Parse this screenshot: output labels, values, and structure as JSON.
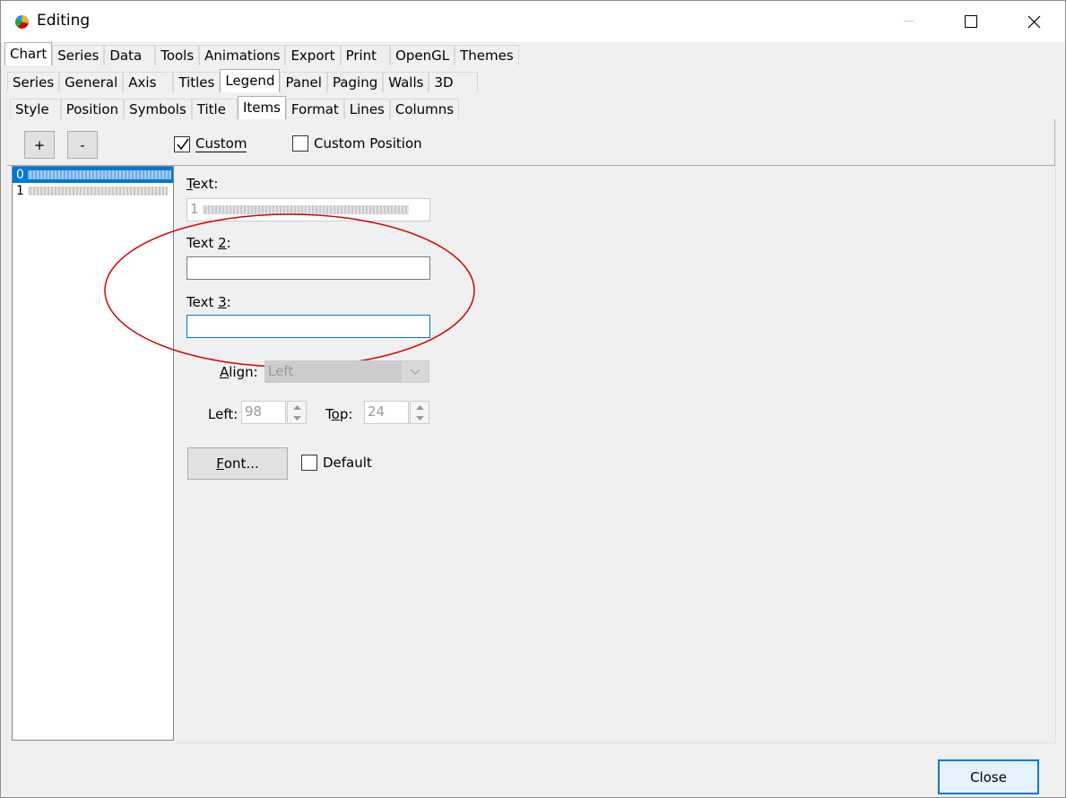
{
  "window": {
    "title": "Editing"
  },
  "tabs_level1": [
    "Chart",
    "Series",
    "Data",
    "Tools",
    "Animations",
    "Export",
    "Print",
    "OpenGL",
    "Themes"
  ],
  "tabs_level2": [
    "Series",
    "General",
    "Axis",
    "Titles",
    "Legend",
    "Panel",
    "Paging",
    "Walls",
    "3D"
  ],
  "tabs_level3": [
    "Style",
    "Position",
    "Symbols",
    "Title",
    "Items",
    "Format",
    "Lines",
    "Columns"
  ],
  "toolbar": {
    "add_label": "+",
    "remove_label": "-",
    "custom_label": "Custom",
    "custom_position_label": "Custom Position"
  },
  "list": {
    "items": [
      "0",
      "1"
    ]
  },
  "fields": {
    "text_label": "ext:",
    "text_prefix": "T",
    "text_value": "1",
    "text2_label_pre": "Text ",
    "text2_label_u": "2",
    "text2_label_post": ":",
    "text3_label_pre": "Text ",
    "text3_label_u": "3",
    "text3_label_post": ":",
    "align_prefix": "A",
    "align_label": "lign:",
    "align_value": "Left",
    "left_label": "Left:",
    "left_value": "98",
    "top_label_pre": "T",
    "top_label_u": "o",
    "top_label_post": "p:",
    "top_value": "24",
    "font_button_u": "F",
    "font_button": "ont...",
    "default_label": "Default"
  },
  "footer": {
    "close_label": "Close"
  },
  "colors": {
    "accent": "#0078d7",
    "annotation": "#d40000"
  }
}
